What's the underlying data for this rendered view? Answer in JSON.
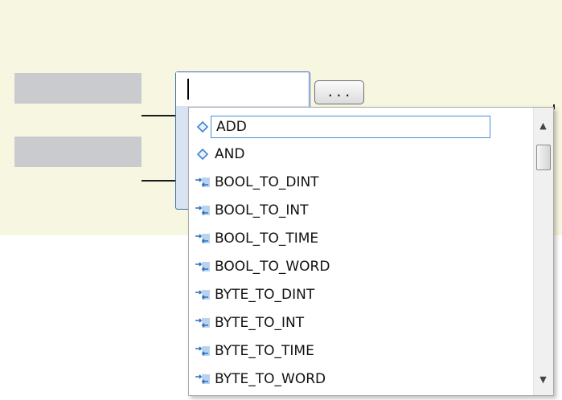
{
  "editor": {
    "input_value": "",
    "browse_button_label": "..."
  },
  "dropdown": {
    "items": [
      {
        "label": "ADD",
        "icon": "function-block-icon",
        "selected": true
      },
      {
        "label": "AND",
        "icon": "function-block-icon",
        "selected": false
      },
      {
        "label": "BOOL_TO_DINT",
        "icon": "conversion-icon",
        "selected": false
      },
      {
        "label": "BOOL_TO_INT",
        "icon": "conversion-icon",
        "selected": false
      },
      {
        "label": "BOOL_TO_TIME",
        "icon": "conversion-icon",
        "selected": false
      },
      {
        "label": "BOOL_TO_WORD",
        "icon": "conversion-icon",
        "selected": false
      },
      {
        "label": "BYTE_TO_DINT",
        "icon": "conversion-icon",
        "selected": false
      },
      {
        "label": "BYTE_TO_INT",
        "icon": "conversion-icon",
        "selected": false
      },
      {
        "label": "BYTE_TO_TIME",
        "icon": "conversion-icon",
        "selected": false
      },
      {
        "label": "BYTE_TO_WORD",
        "icon": "conversion-icon",
        "selected": false
      }
    ],
    "scroll_up_glyph": "▲",
    "scroll_down_glyph": "▼"
  },
  "colors": {
    "editor_background": "#f7f7e1",
    "selection_border": "#4a8fd8",
    "icon_blue": "#3d82d4"
  }
}
